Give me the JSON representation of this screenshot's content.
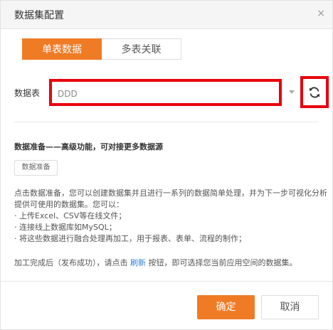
{
  "dialog": {
    "title": "数据集配置",
    "close_glyph": "×"
  },
  "tabs": [
    {
      "label": "单表数据",
      "active": true
    },
    {
      "label": "多表关联",
      "active": false
    }
  ],
  "datasource": {
    "label": "数据表",
    "value": "DDD",
    "refresh_icon": "refresh-icon"
  },
  "prep": {
    "section_title": "数据准备——高级功能，可对接更多数据源",
    "button_label": "数据准备",
    "desc_lines": [
      "点击数据准备，您可以创建数据集并且进行一系列的数据简单处理，并为下一步可视化分析",
      "提供可使用的数据集。您可以：",
      "· 上传Excel、CSV等在线文件；",
      "· 连接线上数据库如MySQL；",
      "· 将这些数据进行融合处理再加工，用于报表、表单、流程的制作；"
    ],
    "final_prefix": "加工完成后（发布成功），请点击 ",
    "final_link": "刷新",
    "final_suffix": " 按钮，即可选择您当前应用空间的数据集。"
  },
  "footer": {
    "ok_label": "确定",
    "cancel_label": "取消"
  },
  "colors": {
    "accent": "#f07b25",
    "highlight": "#e8000b",
    "link": "#2f80d8"
  }
}
